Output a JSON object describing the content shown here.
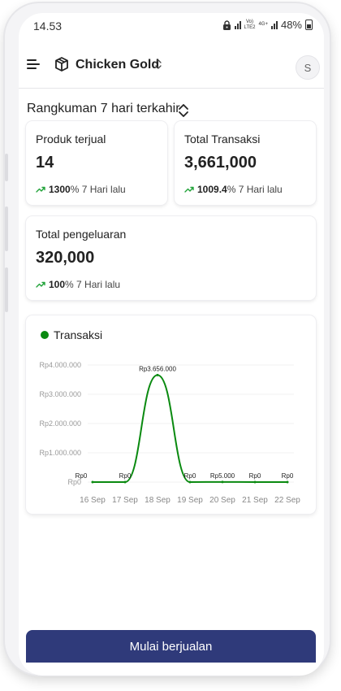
{
  "status_bar": {
    "time": "14.53",
    "battery": "48%",
    "net1": "Vo)",
    "net2": "LTE2",
    "net3": "4G+"
  },
  "header": {
    "store_name": "Chicken Gold",
    "avatar_initial": "S"
  },
  "summary": {
    "title": "Rangkuman 7 hari terkahir"
  },
  "stats": [
    {
      "label": "Produk terjual",
      "value": "14",
      "change": "1300",
      "suffix": "% 7 Hari lalu"
    },
    {
      "label": "Total Transaksi",
      "value": "3,661,000",
      "change": "1009.4",
      "suffix": "% 7 Hari lalu"
    },
    {
      "label": "Total pengeluaran",
      "value": "320,000",
      "change": "100",
      "suffix": "% 7 Hari lalu"
    }
  ],
  "colors": {
    "accent": "#0a8a10",
    "button": "#2f3a7a",
    "trend": "#22a33a"
  },
  "chart_data": {
    "type": "line",
    "categories": [
      "16 Sep",
      "17 Sep",
      "18 Sep",
      "19 Sep",
      "20 Sep",
      "21 Sep",
      "22 Sep"
    ],
    "series": [
      {
        "name": "Transaksi",
        "values": [
          0,
          0,
          3656000,
          0,
          5000,
          0,
          0
        ]
      }
    ],
    "data_labels": [
      "Rp0",
      "Rp0",
      "Rp3.656.000",
      "Rp0",
      "Rp5.000",
      "Rp0",
      "Rp0"
    ],
    "ytick_labels": [
      "Rp0",
      "Rp1.000.000",
      "Rp2.000.000",
      "Rp3.000.000",
      "Rp4.000.000"
    ],
    "ylim": [
      0,
      4000000
    ],
    "grid": true,
    "legend": "top-left"
  },
  "cta": {
    "label": "Mulai berjualan"
  }
}
